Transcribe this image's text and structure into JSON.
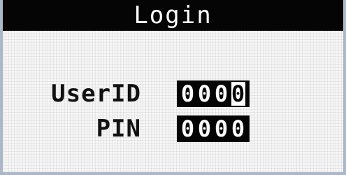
{
  "screen": {
    "title": "Login"
  },
  "form": {
    "userid": {
      "label": "UserID",
      "digits": [
        "0",
        "0",
        "0",
        "0"
      ],
      "cursor_index": 3
    },
    "pin": {
      "label": "PIN",
      "digits": [
        "0",
        "0",
        "0",
        "0"
      ]
    }
  },
  "colors": {
    "title_bar_bg": "#050505",
    "screen_bg": "#f6f6f6",
    "frame": "#aab8c8"
  }
}
